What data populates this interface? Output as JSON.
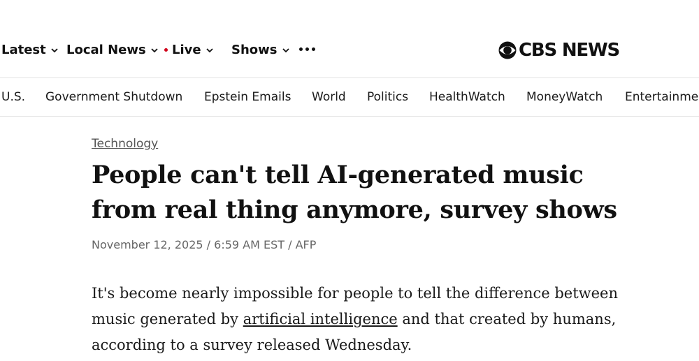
{
  "top_nav": {
    "items": [
      {
        "label": "Latest"
      },
      {
        "label": "Local News"
      },
      {
        "label": "Live"
      },
      {
        "label": "Shows"
      }
    ],
    "more_icon": "ellipsis-icon",
    "logo_text": "CBS NEWS",
    "live_dot_color": "#d0021b"
  },
  "section_nav": {
    "items": [
      "U.S.",
      "Government Shutdown",
      "Epstein Emails",
      "World",
      "Politics",
      "HealthWatch",
      "MoneyWatch",
      "Entertainment"
    ]
  },
  "article": {
    "category": "Technology",
    "headline": "People can't tell AI-generated music from real thing anymore, survey shows",
    "byline": "November 12, 2025 / 6:59 AM EST / AFP",
    "body": {
      "part1": "It's become nearly impossible for people to tell the difference between music generated by ",
      "link": "artificial intelligence",
      "part2": " and that created by humans, according to a survey released Wednesday."
    }
  }
}
